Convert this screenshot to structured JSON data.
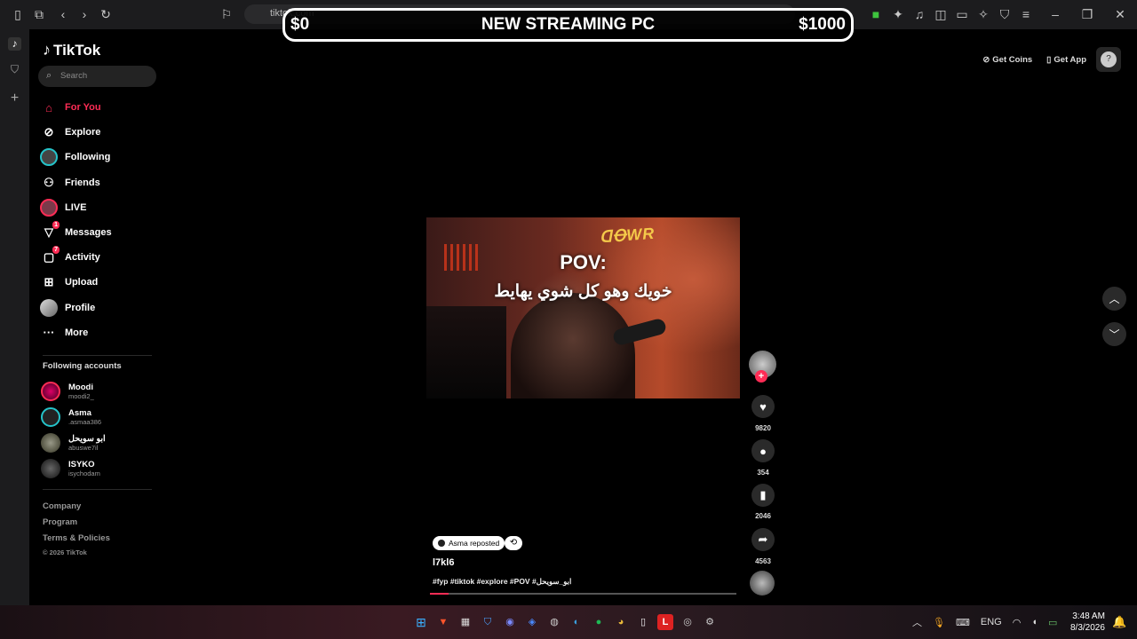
{
  "browser": {
    "url": "tiktok.com"
  },
  "stream_overlay": {
    "left": "$0",
    "center": "NEW STREAMING PC",
    "right": "$1000"
  },
  "sidebar": {
    "logo": "TikTok",
    "search_placeholder": "Search",
    "nav": [
      {
        "label": "For You",
        "icon": "home-icon"
      },
      {
        "label": "Explore",
        "icon": "compass-icon"
      },
      {
        "label": "Following",
        "icon": "following-avatar-icon"
      },
      {
        "label": "Friends",
        "icon": "friends-icon"
      },
      {
        "label": "LIVE",
        "icon": "live-icon"
      },
      {
        "label": "Messages",
        "icon": "messages-icon",
        "badge": "1"
      },
      {
        "label": "Activity",
        "icon": "activity-icon",
        "badge": "7"
      },
      {
        "label": "Upload",
        "icon": "upload-icon"
      },
      {
        "label": "Profile",
        "icon": "profile-icon"
      },
      {
        "label": "More",
        "icon": "more-icon"
      }
    ],
    "following_title": "Following accounts",
    "following": [
      {
        "name": "Moodi",
        "handle": "moodi2_"
      },
      {
        "name": "Asma",
        "handle": ".asmaa386"
      },
      {
        "name": "ابو سويحل",
        "handle": "abuswe7il"
      },
      {
        "name": "ISYKO",
        "handle": "isychodam"
      }
    ],
    "footer": {
      "company": "Company",
      "program": "Program",
      "terms": "Terms & Policies",
      "copyright": "© 2026 TikTok"
    }
  },
  "topbar": {
    "get_coins": "Get Coins",
    "get_app": "Get App"
  },
  "video": {
    "caption_line1": "POV:",
    "caption_line2": "خويك وهو كل شوي يهايط",
    "repost_label": "Asma reposted",
    "username": "l7kl6",
    "hashtags": "#fyp #tiktok #explore #POV #ابو_سويحل",
    "progress": 0.06
  },
  "actions": {
    "likes": "9820",
    "comments": "354",
    "saves": "2046",
    "shares": "4563"
  },
  "taskbar": {
    "language": "ENG",
    "time": "3:48 AM",
    "date": "8/3/2026"
  },
  "colors": {
    "accent": "#fe2c55",
    "following_ring": "#25c3c9"
  }
}
